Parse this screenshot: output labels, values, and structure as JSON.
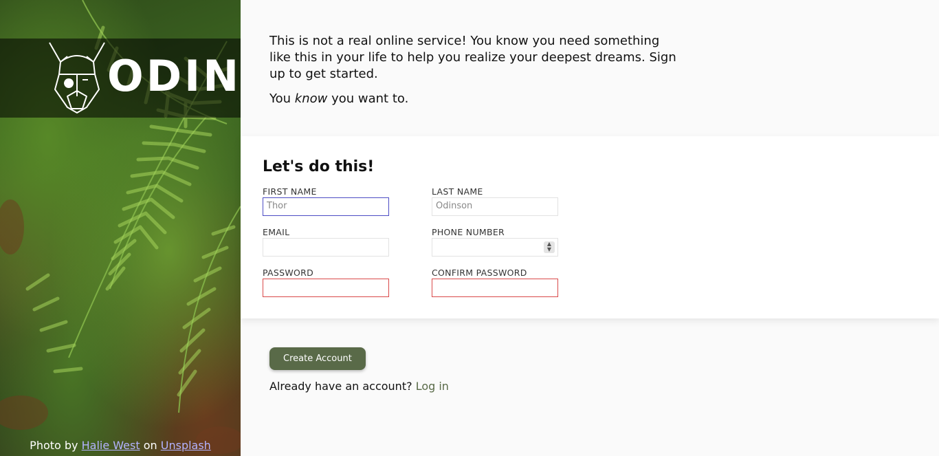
{
  "brand": {
    "logo_text": "ODIN"
  },
  "credit": {
    "prefix": "Photo by",
    "author": "Halie West",
    "middle": "on",
    "source": "Unsplash"
  },
  "intro": {
    "line1": "This is not a real online service! You know you need something like this in your life to help you realize your deepest dreams. Sign up to get started.",
    "line2_before": "You",
    "line2_em": "know",
    "line2_after": "you want to."
  },
  "form": {
    "title": "Let's do this!",
    "fields": {
      "first_name": {
        "label": "FIRST NAME",
        "placeholder": "Thor"
      },
      "last_name": {
        "label": "LAST NAME",
        "placeholder": "Odinson"
      },
      "email": {
        "label": "EMAIL",
        "placeholder": ""
      },
      "phone": {
        "label": "PHONE NUMBER",
        "placeholder": ""
      },
      "password": {
        "label": "PASSWORD",
        "placeholder": ""
      },
      "confirm_password": {
        "label": "CONFIRM PASSWORD",
        "placeholder": ""
      }
    }
  },
  "actions": {
    "create_label": "Create Account",
    "login_prompt": "Already have an account?",
    "login_link": "Log in"
  },
  "colors": {
    "accent": "#596a48",
    "invalid": "#d94848",
    "focus": "#4b4bc4",
    "link_credit": "#b3b3ff"
  }
}
